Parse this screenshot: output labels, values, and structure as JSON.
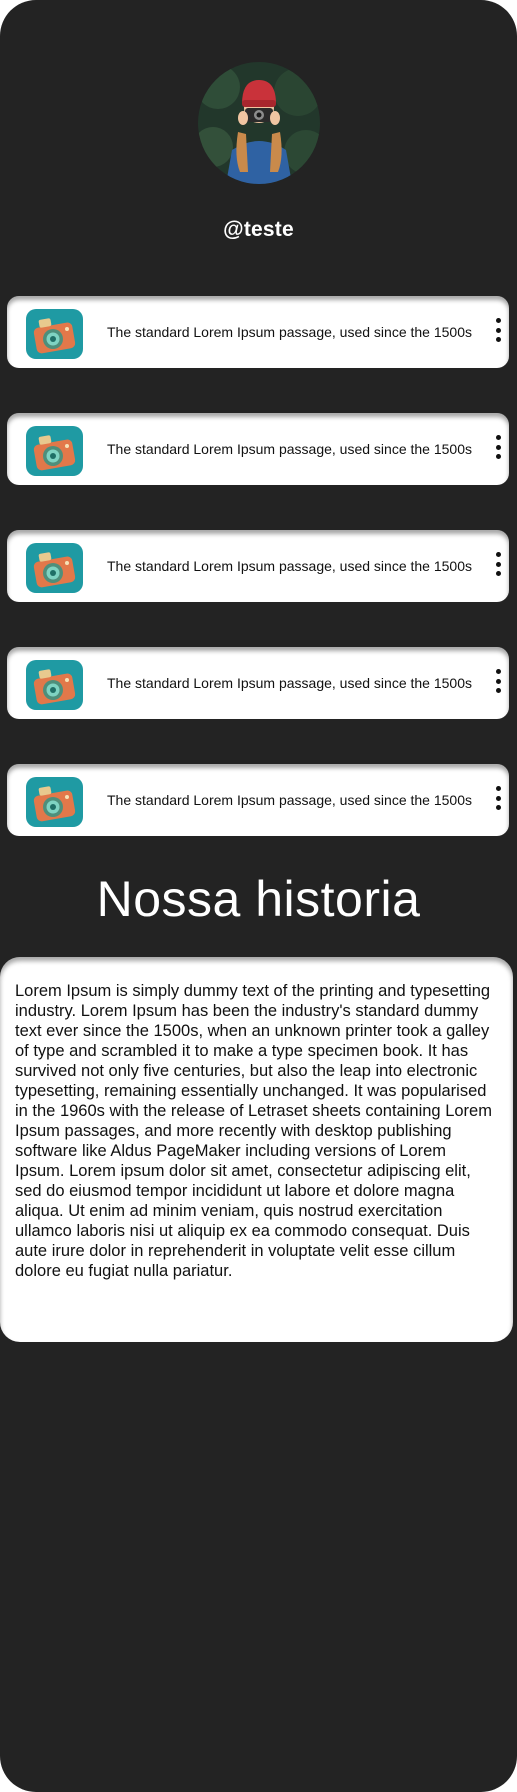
{
  "profile": {
    "handle": "@teste",
    "avatar_icon": "profile-photo-camera-person"
  },
  "links": [
    {
      "text": "The standard Lorem Ipsum passage, used since the 1500s",
      "icon": "camera-app-icon",
      "menu_icon": "more-vertical-icon"
    },
    {
      "text": "The standard Lorem Ipsum passage, used since the 1500s",
      "icon": "camera-app-icon",
      "menu_icon": "more-vertical-icon"
    },
    {
      "text": "The standard Lorem Ipsum passage, used since the 1500s",
      "icon": "camera-app-icon",
      "menu_icon": "more-vertical-icon"
    },
    {
      "text": "The standard Lorem Ipsum passage, used since the 1500s",
      "icon": "camera-app-icon",
      "menu_icon": "more-vertical-icon"
    },
    {
      "text": "The standard Lorem Ipsum passage, used since the 1500s",
      "icon": "camera-app-icon",
      "menu_icon": "more-vertical-icon"
    }
  ],
  "story": {
    "title": "Nossa historia",
    "body": "Lorem Ipsum is simply dummy text of the printing and typesetting industry. Lorem Ipsum has been the industry's standard dummy text ever since the 1500s, when an unknown printer took a galley of type and scrambled it to make a type specimen book. It has survived not only five centuries, but also the leap into electronic typesetting, remaining essentially unchanged. It was popularised in the 1960s with the release of Letraset sheets containing Lorem Ipsum passages, and more recently with desktop publishing software like Aldus PageMaker including versions of Lorem Ipsum. Lorem ipsum dolor sit amet, consectetur adipiscing elit, sed do eiusmod tempor incididunt ut labore et dolore magna aliqua. Ut enim ad minim veniam, quis nostrud exercitation ullamco laboris nisi ut aliquip ex ea commodo consequat. Duis aute irure dolor in reprehenderit in voluptate velit esse cillum dolore eu fugiat nulla pariatur."
  },
  "colors": {
    "background": "#232323",
    "card": "#ffffff",
    "icon_teal": "#1f9aa3",
    "camera_orange": "#e2784a"
  }
}
